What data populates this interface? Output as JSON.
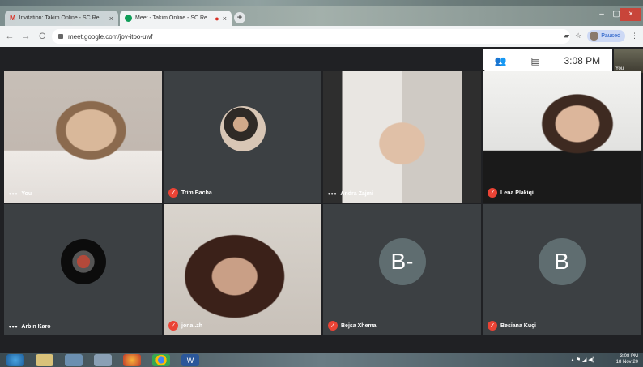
{
  "browser": {
    "tabs": [
      {
        "title": "Invitation: Takim Online - SC Re",
        "favicon": "gmail-icon",
        "active": false
      },
      {
        "title": "Meet - Takim Online - SC Re",
        "favicon": "meet-icon",
        "active": true,
        "recording": true
      }
    ],
    "new_tab": "+",
    "window_controls": {
      "minimize": "–",
      "maximize": "▢",
      "close": "×"
    },
    "url": "meet.google.com/jov-itoo-uwf",
    "profile_status": "Paused",
    "nav": {
      "back": "←",
      "forward": "→",
      "reload": "C"
    },
    "toolbar_icons": [
      "cast-icon",
      "star-icon",
      "menu-icon"
    ]
  },
  "meet": {
    "time": "3:08 PM",
    "self_label": "You",
    "participants": [
      {
        "name": "You",
        "video": "you",
        "muted": false,
        "more": "•••"
      },
      {
        "name": "Trim Bacha",
        "avatar": "photo",
        "muted": true
      },
      {
        "name": "Andra Zajmi",
        "video": "andra",
        "muted": false,
        "more": "•••"
      },
      {
        "name": "Lena Plakiqi",
        "video": "lena",
        "muted": true
      },
      {
        "name": "Arbin Karo",
        "avatar": "photo",
        "muted": false,
        "more": "•••"
      },
      {
        "name": "jona .zh",
        "video": "jona",
        "muted": true
      },
      {
        "name": "Bejsa Xhema",
        "letter": "B-",
        "muted": true
      },
      {
        "name": "Besiana Kuçi",
        "letter": "B",
        "muted": true
      }
    ]
  },
  "taskbar": {
    "clock_time": "3:08 PM",
    "clock_date": "18 Nov 20",
    "icons": [
      "windows-start-icon",
      "file-explorer-icon",
      "media-player-icon",
      "task-icon",
      "firefox-icon",
      "chrome-icon",
      "word-icon"
    ]
  },
  "colors": {
    "mic_off": "#ea4335",
    "tile_bg": "#3c4043",
    "meet_bg": "#202124",
    "letter_avatar": "#5f6d70"
  }
}
